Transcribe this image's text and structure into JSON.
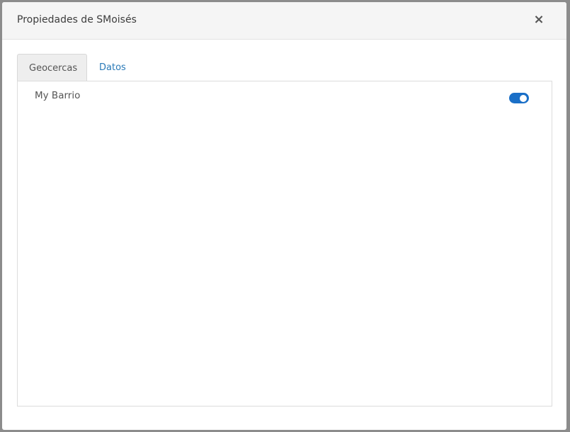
{
  "dialog": {
    "title": "Propiedades de SMoisés",
    "close_symbol": "×"
  },
  "tabs": [
    {
      "label": "Geocercas",
      "active": true
    },
    {
      "label": "Datos",
      "active": false
    }
  ],
  "geofences": [
    {
      "name": "My Barrio",
      "enabled": true
    }
  ],
  "colors": {
    "accent": "#1a6fc7",
    "link": "#2a7ab8"
  }
}
